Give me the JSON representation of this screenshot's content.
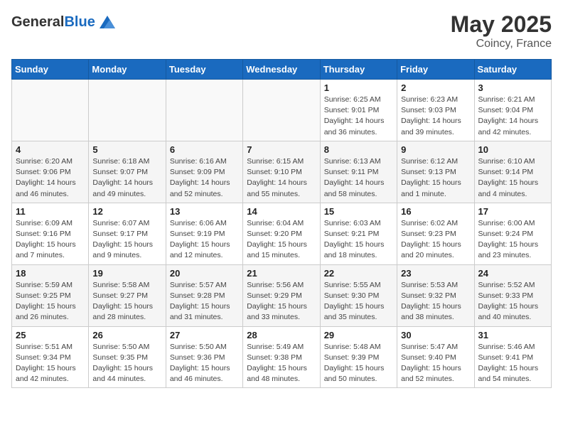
{
  "header": {
    "logo_general": "General",
    "logo_blue": "Blue",
    "title": "May 2025",
    "location": "Coincy, France"
  },
  "days_of_week": [
    "Sunday",
    "Monday",
    "Tuesday",
    "Wednesday",
    "Thursday",
    "Friday",
    "Saturday"
  ],
  "weeks": [
    [
      {
        "day": "",
        "detail": ""
      },
      {
        "day": "",
        "detail": ""
      },
      {
        "day": "",
        "detail": ""
      },
      {
        "day": "",
        "detail": ""
      },
      {
        "day": "1",
        "detail": "Sunrise: 6:25 AM\nSunset: 9:01 PM\nDaylight: 14 hours\nand 36 minutes."
      },
      {
        "day": "2",
        "detail": "Sunrise: 6:23 AM\nSunset: 9:03 PM\nDaylight: 14 hours\nand 39 minutes."
      },
      {
        "day": "3",
        "detail": "Sunrise: 6:21 AM\nSunset: 9:04 PM\nDaylight: 14 hours\nand 42 minutes."
      }
    ],
    [
      {
        "day": "4",
        "detail": "Sunrise: 6:20 AM\nSunset: 9:06 PM\nDaylight: 14 hours\nand 46 minutes."
      },
      {
        "day": "5",
        "detail": "Sunrise: 6:18 AM\nSunset: 9:07 PM\nDaylight: 14 hours\nand 49 minutes."
      },
      {
        "day": "6",
        "detail": "Sunrise: 6:16 AM\nSunset: 9:09 PM\nDaylight: 14 hours\nand 52 minutes."
      },
      {
        "day": "7",
        "detail": "Sunrise: 6:15 AM\nSunset: 9:10 PM\nDaylight: 14 hours\nand 55 minutes."
      },
      {
        "day": "8",
        "detail": "Sunrise: 6:13 AM\nSunset: 9:11 PM\nDaylight: 14 hours\nand 58 minutes."
      },
      {
        "day": "9",
        "detail": "Sunrise: 6:12 AM\nSunset: 9:13 PM\nDaylight: 15 hours\nand 1 minute."
      },
      {
        "day": "10",
        "detail": "Sunrise: 6:10 AM\nSunset: 9:14 PM\nDaylight: 15 hours\nand 4 minutes."
      }
    ],
    [
      {
        "day": "11",
        "detail": "Sunrise: 6:09 AM\nSunset: 9:16 PM\nDaylight: 15 hours\nand 7 minutes."
      },
      {
        "day": "12",
        "detail": "Sunrise: 6:07 AM\nSunset: 9:17 PM\nDaylight: 15 hours\nand 9 minutes."
      },
      {
        "day": "13",
        "detail": "Sunrise: 6:06 AM\nSunset: 9:19 PM\nDaylight: 15 hours\nand 12 minutes."
      },
      {
        "day": "14",
        "detail": "Sunrise: 6:04 AM\nSunset: 9:20 PM\nDaylight: 15 hours\nand 15 minutes."
      },
      {
        "day": "15",
        "detail": "Sunrise: 6:03 AM\nSunset: 9:21 PM\nDaylight: 15 hours\nand 18 minutes."
      },
      {
        "day": "16",
        "detail": "Sunrise: 6:02 AM\nSunset: 9:23 PM\nDaylight: 15 hours\nand 20 minutes."
      },
      {
        "day": "17",
        "detail": "Sunrise: 6:00 AM\nSunset: 9:24 PM\nDaylight: 15 hours\nand 23 minutes."
      }
    ],
    [
      {
        "day": "18",
        "detail": "Sunrise: 5:59 AM\nSunset: 9:25 PM\nDaylight: 15 hours\nand 26 minutes."
      },
      {
        "day": "19",
        "detail": "Sunrise: 5:58 AM\nSunset: 9:27 PM\nDaylight: 15 hours\nand 28 minutes."
      },
      {
        "day": "20",
        "detail": "Sunrise: 5:57 AM\nSunset: 9:28 PM\nDaylight: 15 hours\nand 31 minutes."
      },
      {
        "day": "21",
        "detail": "Sunrise: 5:56 AM\nSunset: 9:29 PM\nDaylight: 15 hours\nand 33 minutes."
      },
      {
        "day": "22",
        "detail": "Sunrise: 5:55 AM\nSunset: 9:30 PM\nDaylight: 15 hours\nand 35 minutes."
      },
      {
        "day": "23",
        "detail": "Sunrise: 5:53 AM\nSunset: 9:32 PM\nDaylight: 15 hours\nand 38 minutes."
      },
      {
        "day": "24",
        "detail": "Sunrise: 5:52 AM\nSunset: 9:33 PM\nDaylight: 15 hours\nand 40 minutes."
      }
    ],
    [
      {
        "day": "25",
        "detail": "Sunrise: 5:51 AM\nSunset: 9:34 PM\nDaylight: 15 hours\nand 42 minutes."
      },
      {
        "day": "26",
        "detail": "Sunrise: 5:50 AM\nSunset: 9:35 PM\nDaylight: 15 hours\nand 44 minutes."
      },
      {
        "day": "27",
        "detail": "Sunrise: 5:50 AM\nSunset: 9:36 PM\nDaylight: 15 hours\nand 46 minutes."
      },
      {
        "day": "28",
        "detail": "Sunrise: 5:49 AM\nSunset: 9:38 PM\nDaylight: 15 hours\nand 48 minutes."
      },
      {
        "day": "29",
        "detail": "Sunrise: 5:48 AM\nSunset: 9:39 PM\nDaylight: 15 hours\nand 50 minutes."
      },
      {
        "day": "30",
        "detail": "Sunrise: 5:47 AM\nSunset: 9:40 PM\nDaylight: 15 hours\nand 52 minutes."
      },
      {
        "day": "31",
        "detail": "Sunrise: 5:46 AM\nSunset: 9:41 PM\nDaylight: 15 hours\nand 54 minutes."
      }
    ]
  ]
}
